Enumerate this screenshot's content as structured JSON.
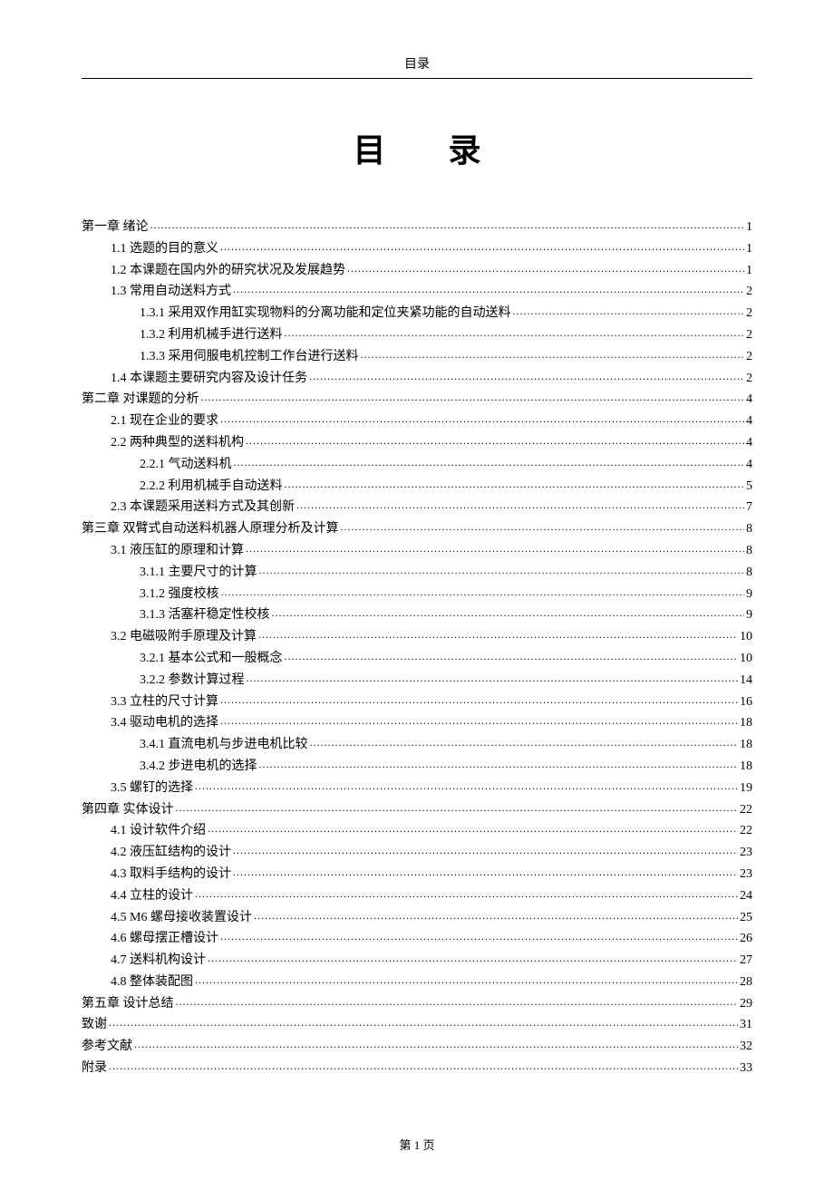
{
  "header_label": "目录",
  "main_title": "目 录",
  "footer": "第 1 页",
  "toc": [
    {
      "label": "第一章  绪论",
      "page": "1",
      "indent": 0
    },
    {
      "label": "1.1 选题的目的意义",
      "page": "1",
      "indent": 1
    },
    {
      "label": "1.2 本课题在国内外的研究状况及发展趋势",
      "page": "1",
      "indent": 1
    },
    {
      "label": "1.3 常用自动送料方式",
      "page": "2",
      "indent": 1
    },
    {
      "label": "1.3.1 采用双作用缸实现物料的分离功能和定位夹紧功能的自动送料",
      "page": "2",
      "indent": 2
    },
    {
      "label": "1.3.2 利用机械手进行送料",
      "page": "2",
      "indent": 2
    },
    {
      "label": "1.3.3 采用伺服电机控制工作台进行送料",
      "page": "2",
      "indent": 2
    },
    {
      "label": "1.4 本课题主要研究内容及设计任务",
      "page": "2",
      "indent": 1
    },
    {
      "label": "第二章  对课题的分析",
      "page": "4",
      "indent": 0
    },
    {
      "label": "2.1 现在企业的要求",
      "page": "4",
      "indent": 1
    },
    {
      "label": "2.2 两种典型的送料机构",
      "page": "4",
      "indent": 1
    },
    {
      "label": "2.2.1 气动送料机",
      "page": "4",
      "indent": 2
    },
    {
      "label": "2.2.2 利用机械手自动送料",
      "page": "5",
      "indent": 2
    },
    {
      "label": "2.3 本课题采用送料方式及其创新",
      "page": "7",
      "indent": 1
    },
    {
      "label": "第三章  双臂式自动送料机器人原理分析及计算",
      "page": "8",
      "indent": 0
    },
    {
      "label": "3.1 液压缸的原理和计算",
      "page": "8",
      "indent": 1
    },
    {
      "label": "3.1.1 主要尺寸的计算",
      "page": "8",
      "indent": 2
    },
    {
      "label": "3.1.2 强度校核",
      "page": "9",
      "indent": 2
    },
    {
      "label": "3.1.3 活塞杆稳定性校核",
      "page": "9",
      "indent": 2
    },
    {
      "label": "3.2 电磁吸附手原理及计算",
      "page": "10",
      "indent": 1
    },
    {
      "label": "3.2.1  基本公式和一般概念",
      "page": "10",
      "indent": 2
    },
    {
      "label": "3.2.2  参数计算过程",
      "page": "14",
      "indent": 2
    },
    {
      "label": "3.3 立柱的尺寸计算",
      "page": "16",
      "indent": 1
    },
    {
      "label": "3.4  驱动电机的选择",
      "page": "18",
      "indent": 1
    },
    {
      "label": "3.4.1 直流电机与步进电机比较",
      "page": "18",
      "indent": 2
    },
    {
      "label": "3.4.2 步进电机的选择",
      "page": "18",
      "indent": 2
    },
    {
      "label": "3.5 螺钉的选择",
      "page": "19",
      "indent": 1
    },
    {
      "label": "第四章  实体设计",
      "page": "22",
      "indent": 0
    },
    {
      "label": "4.1 设计软件介绍",
      "page": "22",
      "indent": 1
    },
    {
      "label": "4.2 液压缸结构的设计",
      "page": "23",
      "indent": 1
    },
    {
      "label": "4.3 取料手结构的设计",
      "page": "23",
      "indent": 1
    },
    {
      "label": "4.4 立柱的设计",
      "page": "24",
      "indent": 1
    },
    {
      "label": "4.5 M6 螺母接收装置设计",
      "page": "25",
      "indent": 1
    },
    {
      "label": "4.6 螺母摆正槽设计",
      "page": "26",
      "indent": 1
    },
    {
      "label": "4.7 送料机构设计",
      "page": "27",
      "indent": 1
    },
    {
      "label": "4.8  整体装配图",
      "page": "28",
      "indent": 1
    },
    {
      "label": "第五章  设计总结",
      "page": "29",
      "indent": 0
    },
    {
      "label": "致谢",
      "page": "31",
      "indent": 0
    },
    {
      "label": "参考文献",
      "page": "32",
      "indent": 0
    },
    {
      "label": "附录",
      "page": "33",
      "indent": 0
    }
  ]
}
